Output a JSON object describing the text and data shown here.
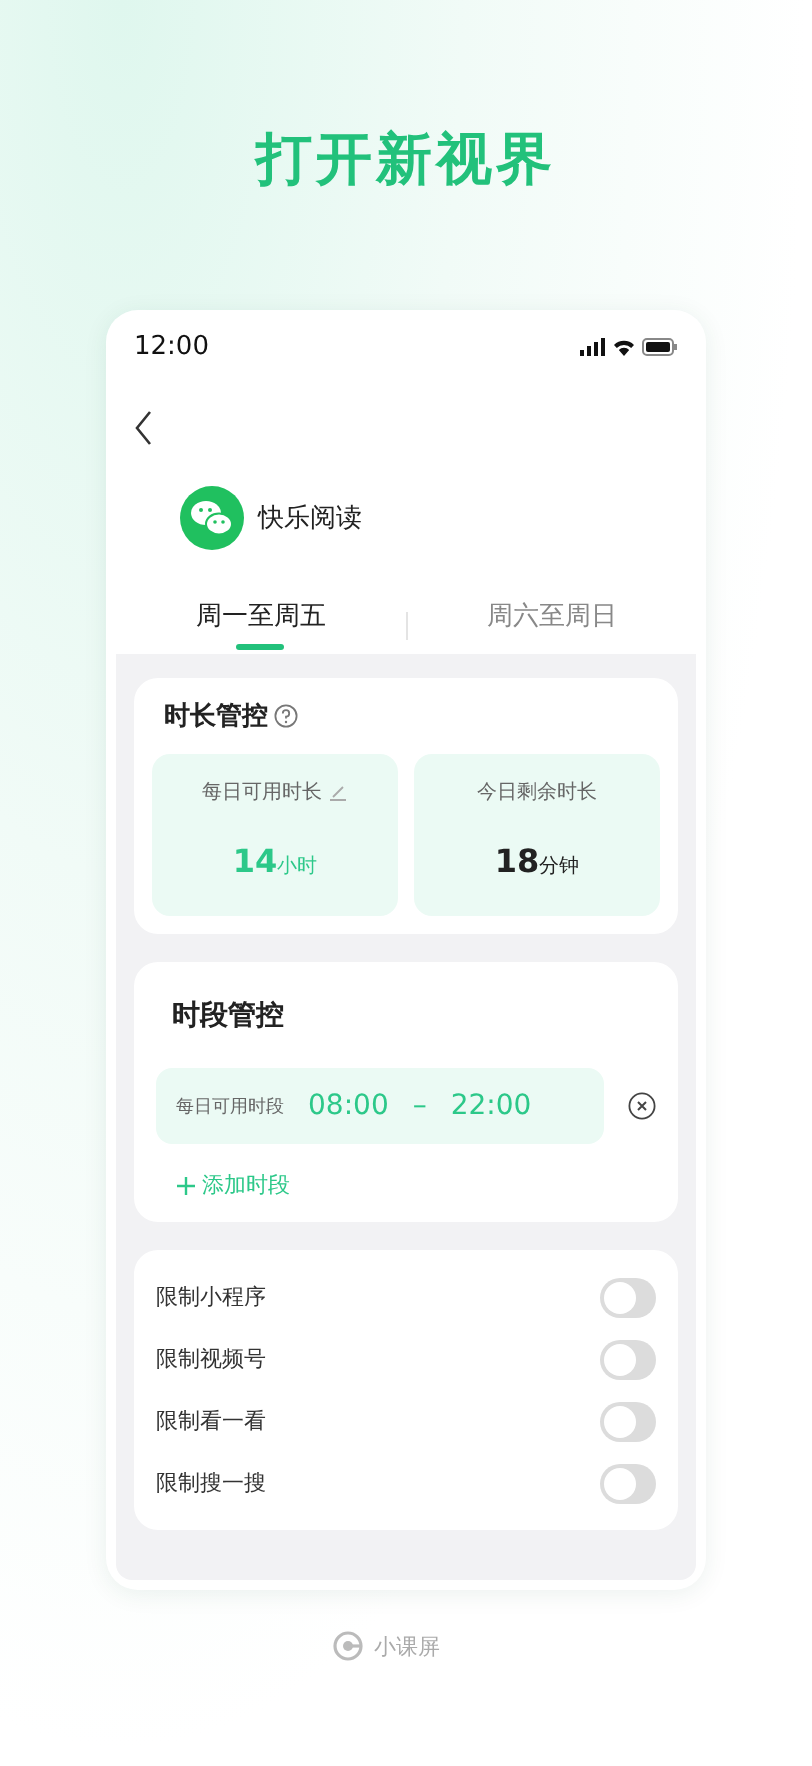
{
  "heading": "打开新视界",
  "status_bar": {
    "time": "12:00"
  },
  "app": {
    "name": "快乐阅读"
  },
  "tabs": [
    {
      "label": "周一至周五",
      "selected": true
    },
    {
      "label": "周六至周日",
      "selected": false
    }
  ],
  "duration_control": {
    "title": "时长管控",
    "items": [
      {
        "label": "每日可用时长",
        "value": "14",
        "unit": "小时",
        "editable": true,
        "highlighted": true
      },
      {
        "label": "今日剩余时长",
        "value": "18",
        "unit": "分钟",
        "editable": false,
        "highlighted": false
      }
    ]
  },
  "period_control": {
    "title": "时段管控",
    "period": {
      "label": "每日可用时段",
      "start": "08:00",
      "separator": "–",
      "end": "22:00"
    },
    "add_label": "添加时段"
  },
  "restrictions": [
    {
      "label": "限制小程序",
      "on": false
    },
    {
      "label": "限制视频号",
      "on": false
    },
    {
      "label": "限制看一看",
      "on": false
    },
    {
      "label": "限制搜一搜",
      "on": false
    }
  ],
  "footer": {
    "brand": "小课屏"
  }
}
